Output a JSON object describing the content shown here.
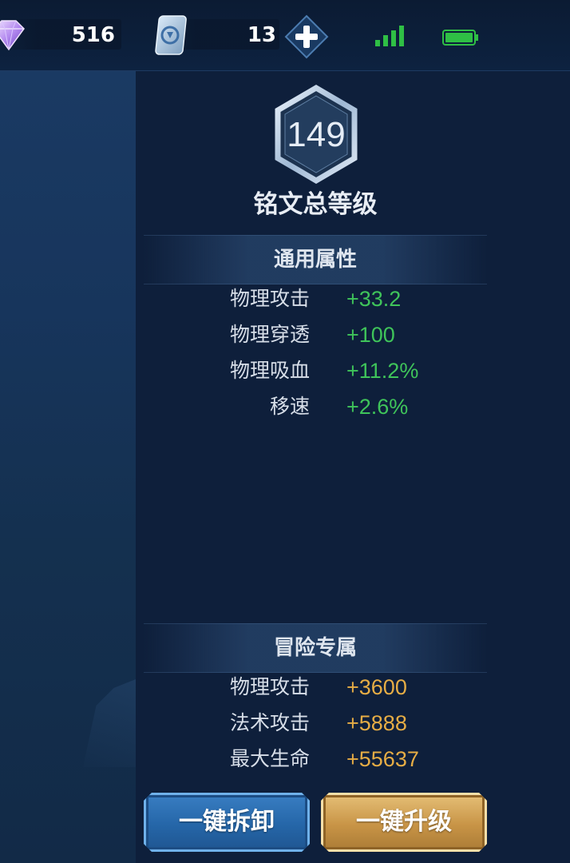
{
  "status_bar": {
    "gems": "516",
    "cards": "13",
    "icons": [
      "gem-icon",
      "card-icon",
      "plus-icon",
      "signal-icon",
      "battery-icon"
    ]
  },
  "inscription": {
    "total_level": "149",
    "total_level_label": "铭文总等级"
  },
  "general_attributes": {
    "title": "通用属性",
    "rows": [
      {
        "label": "物理攻击",
        "value": "+33.2"
      },
      {
        "label": "物理穿透",
        "value": "+100"
      },
      {
        "label": "物理吸血",
        "value": "+11.2%"
      },
      {
        "label": "移速",
        "value": "+2.6%"
      }
    ]
  },
  "adventure_attributes": {
    "title": "冒险专属",
    "rows": [
      {
        "label": "物理攻击",
        "value": "+3600"
      },
      {
        "label": "法术攻击",
        "value": "+5888"
      },
      {
        "label": "最大生命",
        "value": "+55637"
      }
    ]
  },
  "actions": {
    "dismantle_all": "一键拆卸",
    "upgrade_all": "一键升级"
  },
  "colors": {
    "general_value": "#3fc45a",
    "adventure_value": "#e6ad45"
  }
}
